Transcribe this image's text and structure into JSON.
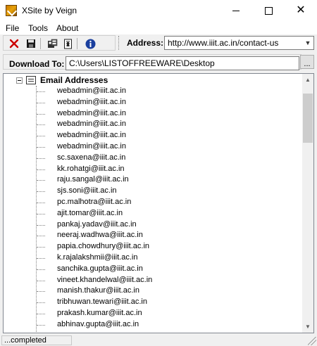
{
  "window": {
    "title": "XSite by Veign",
    "minimize_icon": "minimize-icon",
    "maximize_icon": "maximize-icon",
    "close_glyph": "✕"
  },
  "menu": [
    {
      "label": "File"
    },
    {
      "label": "Tools"
    },
    {
      "label": "About"
    }
  ],
  "toolbar": {
    "buttons": [
      "stop-icon",
      "save-icon",
      "database-icon",
      "document-icon",
      "info-icon"
    ],
    "address_label": "Address:",
    "address_value": "http://www.iiit.ac.in/contact-us"
  },
  "download": {
    "label": "Download To:",
    "path": "C:\\Users\\LISTOFFREEWARE\\Desktop",
    "browse_label": "..."
  },
  "tree": {
    "root_label": "Email Addresses",
    "emails": [
      "webadmin@iiit.ac.in",
      "webadmin@iiit.ac.in",
      "webadmin@iiit.ac.in",
      "webadmin@iiit.ac.in",
      "webadmin@iiit.ac.in",
      "webadmin@iiit.ac.in",
      "sc.saxena@iiit.ac.in",
      "kk.rohatgi@iiit.ac.in",
      "raju.sangal@iiit.ac.in",
      "sjs.soni@iiit.ac.in",
      "pc.malhotra@iiit.ac.in",
      "ajit.tomar@iiit.ac.in",
      "pankaj.yadav@iiit.ac.in",
      "neeraj.wadhwa@iiit.ac.in",
      "papia.chowdhury@iiit.ac.in",
      "k.rajalakshmii@iiit.ac.in",
      "sanchika.gupta@iiit.ac.in",
      "vineet.khandelwal@iiit.ac.in",
      "manish.thakur@iiit.ac.in",
      "tribhuwan.tewari@iiit.ac.in",
      "prakash.kumar@iiit.ac.in",
      "abhinav.gupta@iiit.ac.in"
    ]
  },
  "status": {
    "text": "...completed"
  },
  "colors": {
    "stop": "#cc0000",
    "info": "#1a3f9e",
    "save": "#1a1a1a"
  }
}
